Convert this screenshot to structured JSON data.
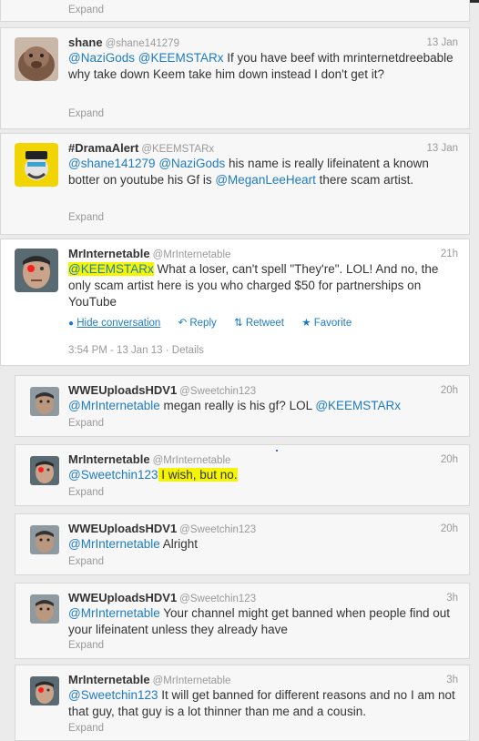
{
  "colors": {
    "mention": "#1f7bc1",
    "highlight": "#f5f500",
    "muted": "#999999"
  },
  "top_expand": "Expand",
  "tweets": [
    {
      "name": "shane",
      "handle": "@shane141279",
      "time": "13 Jan",
      "parts": [
        [
          "m",
          "@NaziGods"
        ],
        [
          "t",
          " "
        ],
        [
          "m",
          "@KEEMSTARx"
        ],
        [
          "t",
          " If you have beef with mrinternetdreebable why take down Keem take him down instead I don't get it?"
        ]
      ],
      "expand": "Expand",
      "avatar": "dog-avatar"
    },
    {
      "name": "#DramaAlert",
      "handle": "@KEEMSTARx",
      "time": "13 Jan",
      "parts": [
        [
          "m",
          "@shane141279"
        ],
        [
          "t",
          " "
        ],
        [
          "m",
          "@NaziGods"
        ],
        [
          "t",
          " his name is really lifeinatent a known botter on youtube his Gf is "
        ],
        [
          "m",
          "@MeganLeeHeart"
        ],
        [
          "t",
          " there scam artist."
        ]
      ],
      "expand": "Expand",
      "avatar": "cartoon-avatar"
    },
    {
      "name": "MrInternetable",
      "handle": "@MrInternetable",
      "time": "21h",
      "parts": [
        [
          "m",
          "@KEEMSTARx"
        ],
        [
          "t",
          " What a loser, can't spell \"They're\". LOL! And no, the only scam artist here is you who charged $50 for partnerships on YouTube"
        ]
      ],
      "actions": {
        "hide": "Hide conversation",
        "reply": "Reply",
        "retweet": "Retweet",
        "favorite": "Favorite"
      },
      "meta": "3:54 PM - 13 Jan 13 · Details",
      "avatar": "red-eye-avatar"
    },
    {
      "name": "WWEUploadsHDV1",
      "handle": "@Sweetchin123",
      "time": "20h",
      "parts": [
        [
          "m",
          "@MrInternetable"
        ],
        [
          "t",
          " megan really is his gf? LOL "
        ],
        [
          "m",
          "@KEEMSTARx"
        ]
      ],
      "expand": "Expand",
      "avatar": "man-avatar"
    },
    {
      "name": "MrInternetable",
      "handle": "@MrInternetable",
      "time": "20h",
      "parts": [
        [
          "m",
          "@Sweetchin123"
        ],
        [
          "t",
          " I wish, but no."
        ]
      ],
      "expand": "Expand",
      "avatar": "red-eye-avatar"
    },
    {
      "name": "WWEUploadsHDV1",
      "handle": "@Sweetchin123",
      "time": "20h",
      "parts": [
        [
          "m",
          "@MrInternetable"
        ],
        [
          "t",
          " Alright"
        ]
      ],
      "expand": "Expand",
      "avatar": "man-avatar"
    },
    {
      "name": "WWEUploadsHDV1",
      "handle": "@Sweetchin123",
      "time": "3h",
      "parts": [
        [
          "m",
          "@MrInternetable"
        ],
        [
          "t",
          " Your channel might get banned when people find out your lifeinatent unless they already have"
        ]
      ],
      "expand": "Expand",
      "avatar": "man-avatar"
    },
    {
      "name": "MrInternetable",
      "handle": "@MrInternetable",
      "time": "3h",
      "parts": [
        [
          "m",
          "@Sweetchin123"
        ],
        [
          "t",
          " It will get banned for different reasons and no I am not that guy, that guy is a lot thinner than me and a cousin."
        ]
      ],
      "expand": "Expand",
      "avatar": "red-eye-avatar"
    }
  ]
}
